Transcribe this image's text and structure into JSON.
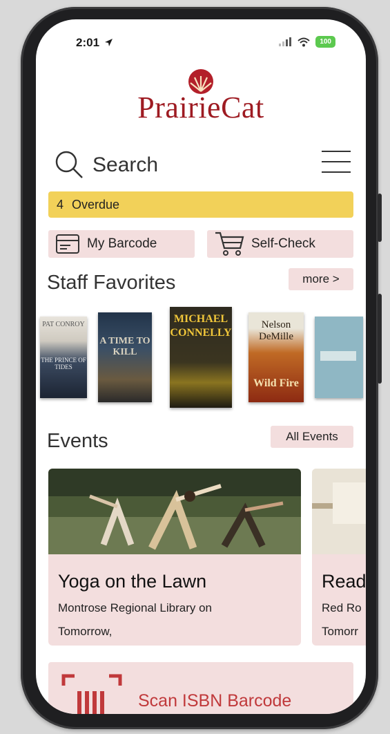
{
  "status_bar": {
    "time": "2:01",
    "battery": "100"
  },
  "app": {
    "logo_text": "PrairieCat"
  },
  "search": {
    "label": "Search"
  },
  "overdue": {
    "count": "4",
    "label": "Overdue"
  },
  "quick_actions": {
    "barcode_label": "My Barcode",
    "selfcheck_label": "Self-Check"
  },
  "staff_favorites": {
    "title": "Staff Favorites",
    "more_label": "more >",
    "books": [
      {
        "author": "PAT CONROY",
        "title": "THE PRINCE OF TIDES"
      },
      {
        "author": "",
        "title": "A TIME TO KILL"
      },
      {
        "author": "MICHAEL CONNELLY",
        "title": ""
      },
      {
        "author": "Nelson DeMille",
        "title": "Wild Fire"
      },
      {
        "author": "",
        "title": ""
      }
    ]
  },
  "events": {
    "title": "Events",
    "all_label": "All Events",
    "items": [
      {
        "title": "Yoga on the Lawn",
        "location": "Montrose Regional Library on",
        "time": "Tomorrow,"
      },
      {
        "title": "Read",
        "location": "Red Ro",
        "time": "Tomorr"
      }
    ]
  },
  "scan": {
    "label": "Scan ISBN Barcode"
  },
  "colors": {
    "brand": "#9e1b22",
    "overdue": "#f2d159",
    "pill_bg": "#f3dede",
    "scan_text": "#c0393b"
  }
}
